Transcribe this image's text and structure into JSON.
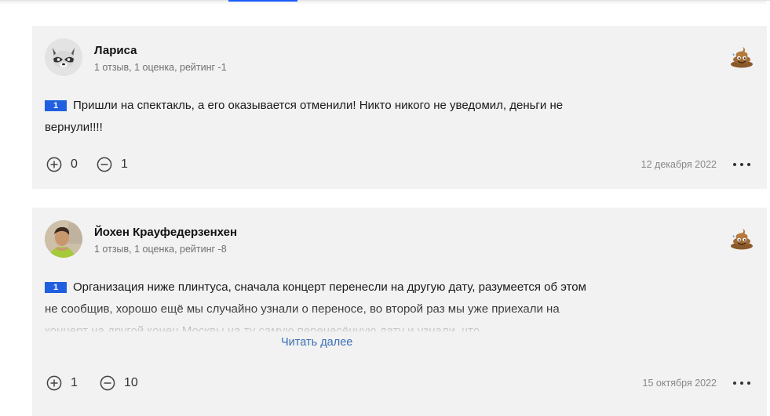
{
  "reviews": [
    {
      "author": "Лариса",
      "stats": "1 отзыв, 1 оценка, рейтинг -1",
      "rating": "1",
      "text": "Пришли на спектакль, а его оказывается отменили! Никто никого не уведомил, деньги не вернули!!!!",
      "likes": "0",
      "dislikes": "1",
      "date": "12 декабря 2022",
      "avatar_icon": "raccoon-avatar",
      "emoji_icon": "poo-emoji-icon"
    },
    {
      "author": "Йохен Крауфедерзенхен",
      "stats": "1 отзыв, 1 оценка, рейтинг -8",
      "rating": "1",
      "text": "Организация ниже плинтуса, сначала концерт перенесли на другую дату, разумеется об этом не сообщив, хорошо ещё мы случайно узнали о переносе, во второй раз мы уже приехали на концерт на другой конец Москвы на ту самую перенесённую дату и узнали, что",
      "read_more": "Читать далее",
      "likes": "1",
      "dislikes": "10",
      "date": "15 октября 2022",
      "avatar_icon": "user-photo-avatar",
      "emoji_icon": "poo-emoji-icon"
    }
  ],
  "colors": {
    "card_bg": "#f2f2f2",
    "badge_bg": "#1f5fe0",
    "link": "#3a6fb5",
    "accent": "#1a5cff"
  }
}
